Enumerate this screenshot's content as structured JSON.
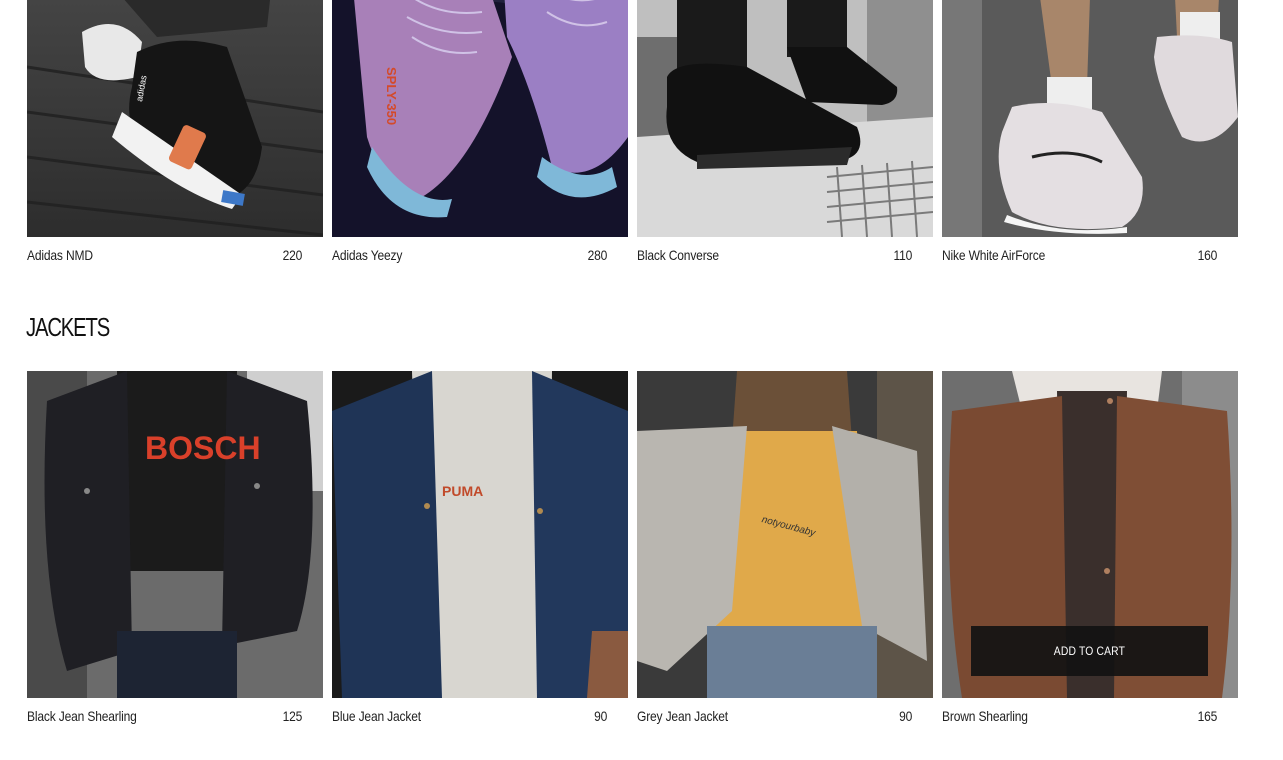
{
  "sneakers": [
    {
      "name": "Adidas NMD",
      "price": "220",
      "image": "adidas-nmd-photo"
    },
    {
      "name": "Adidas Yeezy",
      "price": "280",
      "image": "adidas-yeezy-photo"
    },
    {
      "name": "Black Converse",
      "price": "110",
      "image": "black-converse-photo"
    },
    {
      "name": "Nike White AirForce",
      "price": "160",
      "image": "nike-airforce-photo"
    }
  ],
  "jackets_section": {
    "title": "JACKETS"
  },
  "jackets": [
    {
      "name": "Black Jean Shearling",
      "price": "125",
      "image": "black-jean-shearling-photo"
    },
    {
      "name": "Blue Jean Jacket",
      "price": "90",
      "image": "blue-jean-jacket-photo"
    },
    {
      "name": "Grey Jean Jacket",
      "price": "90",
      "image": "grey-jean-jacket-photo"
    },
    {
      "name": "Brown Shearling",
      "price": "165",
      "image": "brown-shearling-photo",
      "button": "ADD TO CART"
    }
  ],
  "photo_text": {
    "yeezy_tag": "SPLY-350",
    "tshirt_black": "BOSCH",
    "tshirt_blue": "PUMA",
    "tshirt_grey": "notyourbaby"
  }
}
